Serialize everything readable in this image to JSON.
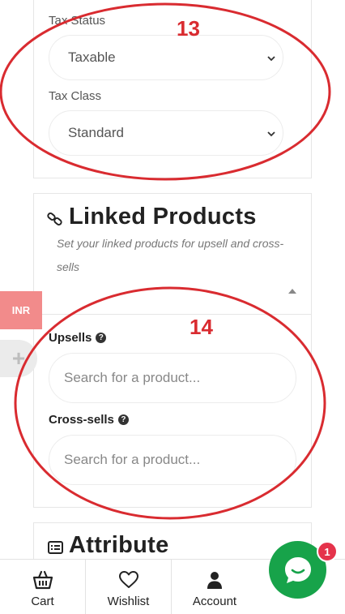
{
  "tax": {
    "status_label": "Tax Status",
    "status_value": "Taxable",
    "class_label": "Tax Class",
    "class_value": "Standard"
  },
  "linked_products": {
    "title": "Linked Products",
    "description": "Set your linked products for upsell and cross-sells",
    "upsells_label": "Upsells",
    "upsells_placeholder": "Search for a product...",
    "crosssells_label": "Cross-sells",
    "crosssells_placeholder": "Search for a product..."
  },
  "attribute": {
    "title": "Attribute"
  },
  "annotations": {
    "first": "13",
    "second": "14",
    "color": "#d92b30"
  },
  "currency_badge": "INR",
  "plus_symbol": "+",
  "bottom_nav": {
    "cart": "Cart",
    "wishlist": "Wishlist",
    "account": "Account"
  },
  "chat": {
    "badge_count": "1",
    "icon": "chat-icon",
    "color": "#17a34a"
  }
}
